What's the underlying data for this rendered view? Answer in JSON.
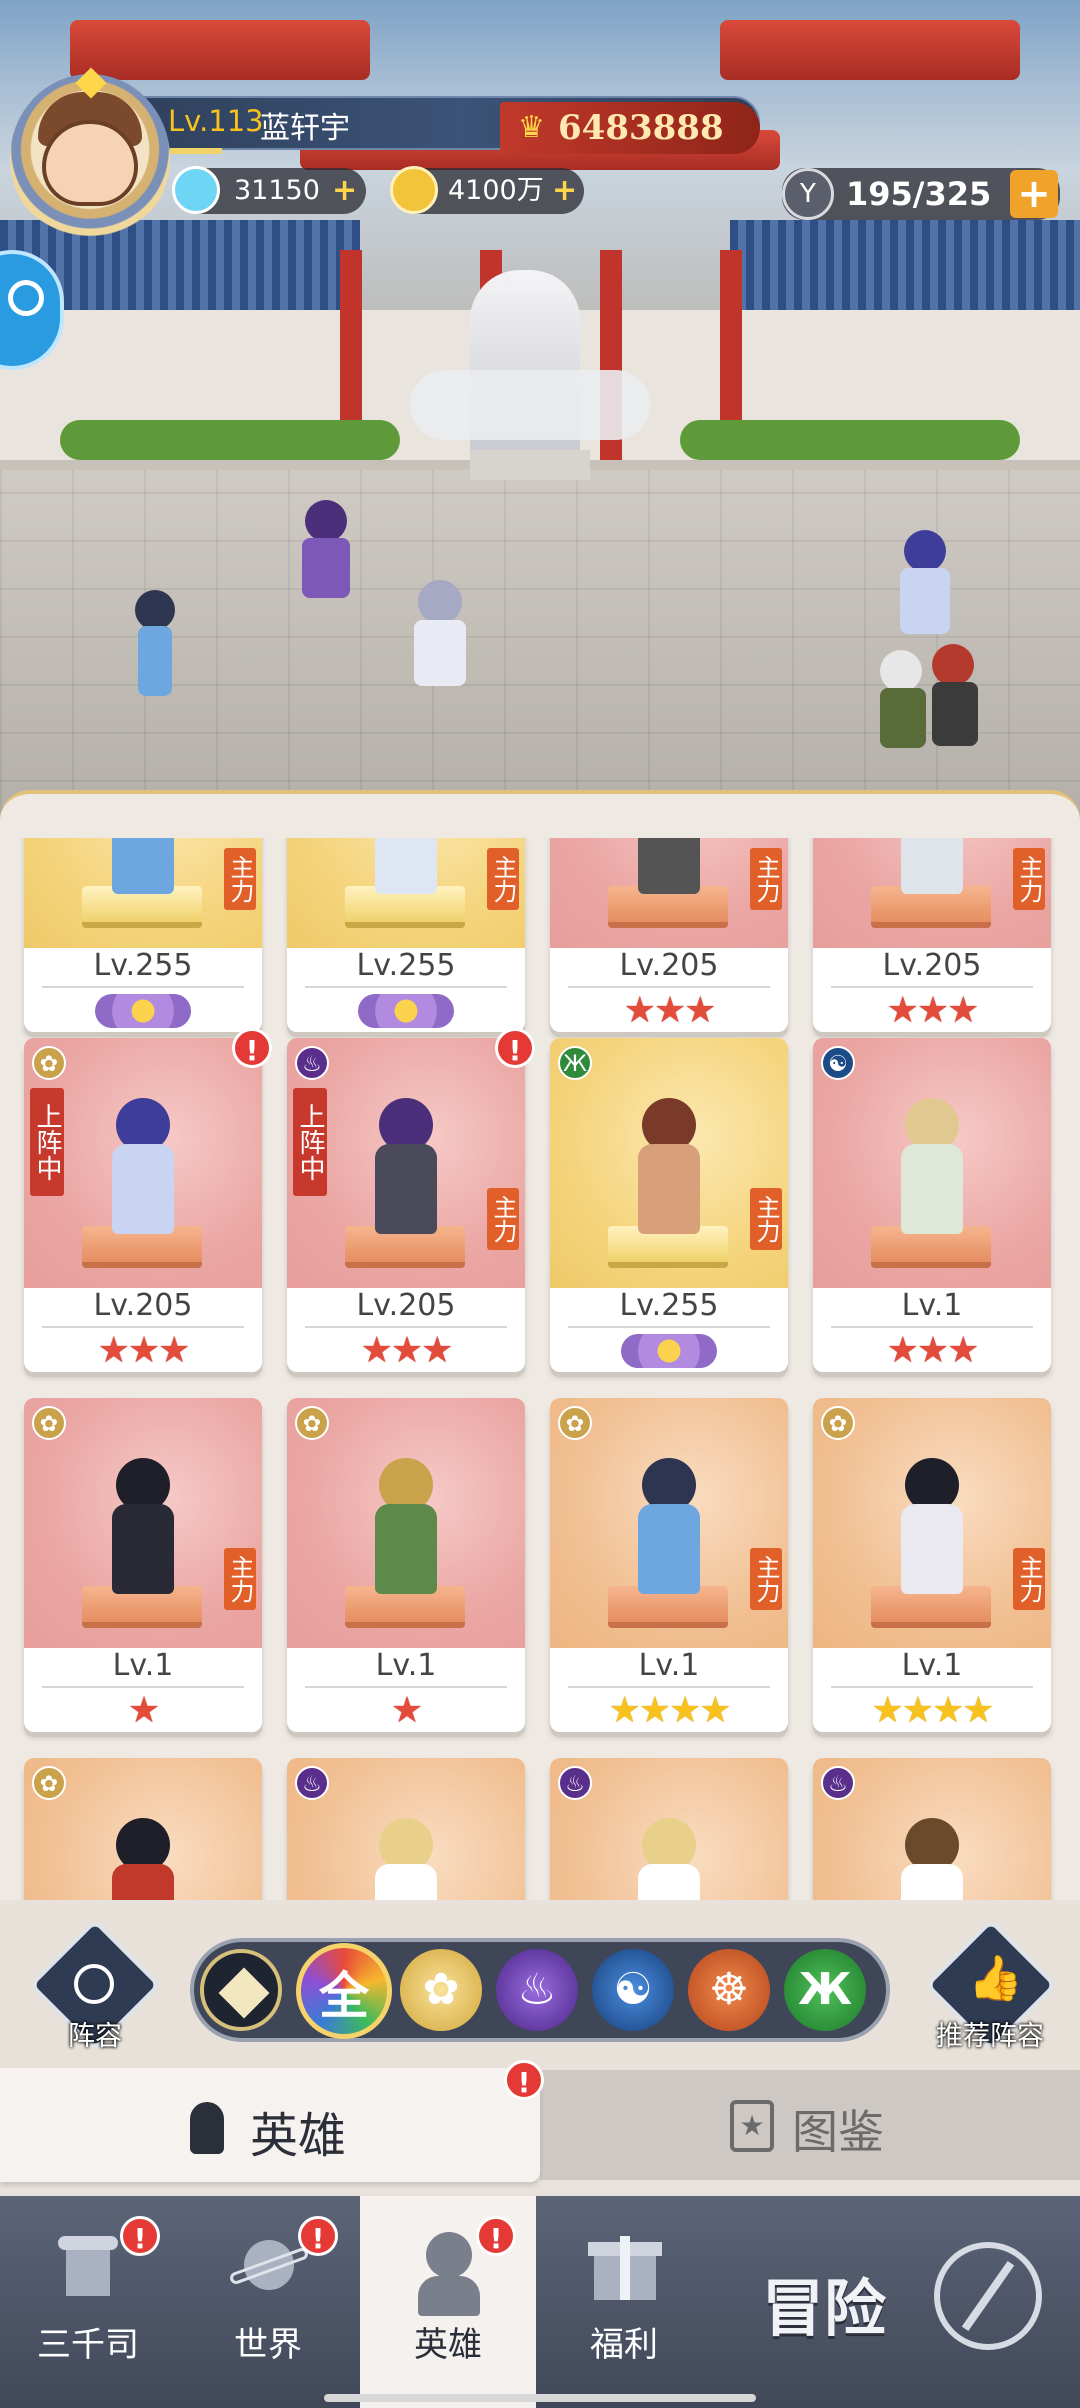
{
  "player": {
    "level": "Lv.113",
    "name": "蓝轩宇",
    "power": "6483888",
    "diamonds": "31150",
    "gold": "4100万",
    "stamina": "195/325"
  },
  "cards": [
    {
      "level": "Lv.255",
      "stars": "",
      "rank": "purple",
      "bg": "gold",
      "faction": "",
      "deployed": false,
      "master": "主力",
      "alert": false
    },
    {
      "level": "Lv.255",
      "stars": "",
      "rank": "purple",
      "bg": "gold",
      "faction": "",
      "deployed": false,
      "master": "主力",
      "alert": false
    },
    {
      "level": "Lv.205",
      "stars": "★★★",
      "rank": "red",
      "bg": "pink",
      "faction": "",
      "deployed": false,
      "master": "主力",
      "alert": false
    },
    {
      "level": "Lv.205",
      "stars": "★★★",
      "rank": "red",
      "bg": "pink",
      "faction": "",
      "deployed": false,
      "master": "主力",
      "alert": false
    },
    {
      "level": "Lv.205",
      "stars": "★★★",
      "rank": "red",
      "bg": "pink",
      "faction": "lotus",
      "deployed": true,
      "master": "",
      "alert": true
    },
    {
      "level": "Lv.205",
      "stars": "★★★",
      "rank": "red",
      "bg": "pink",
      "faction": "flame",
      "deployed": true,
      "master": "主力",
      "alert": true
    },
    {
      "level": "Lv.255",
      "stars": "",
      "rank": "purple",
      "bg": "gold",
      "faction": "dna",
      "deployed": false,
      "master": "主力",
      "alert": false
    },
    {
      "level": "Lv.1",
      "stars": "★★★",
      "rank": "red",
      "bg": "pink",
      "faction": "yin",
      "deployed": false,
      "master": "",
      "alert": false
    },
    {
      "level": "Lv.1",
      "stars": "★",
      "rank": "red",
      "bg": "pink",
      "faction": "lotus",
      "deployed": false,
      "master": "主力",
      "alert": false
    },
    {
      "level": "Lv.1",
      "stars": "★",
      "rank": "red",
      "bg": "pink",
      "faction": "lotus",
      "deployed": false,
      "master": "",
      "alert": false
    },
    {
      "level": "Lv.1",
      "stars": "★★★★",
      "rank": "gold",
      "bg": "orange",
      "faction": "lotus",
      "deployed": false,
      "master": "主力",
      "alert": false
    },
    {
      "level": "Lv.1",
      "stars": "★★★★",
      "rank": "gold",
      "bg": "orange",
      "faction": "lotus",
      "deployed": false,
      "master": "主力",
      "alert": false
    },
    {
      "level": "",
      "stars": "",
      "rank": "red",
      "bg": "orange",
      "faction": "lotus",
      "deployed": false,
      "master": "",
      "alert": false
    },
    {
      "level": "",
      "stars": "",
      "rank": "red",
      "bg": "orange",
      "faction": "flame",
      "deployed": false,
      "master": "",
      "alert": false
    },
    {
      "level": "",
      "stars": "",
      "rank": "red",
      "bg": "orange",
      "faction": "flame",
      "deployed": false,
      "master": "",
      "alert": false
    },
    {
      "level": "",
      "stars": "",
      "rank": "red",
      "bg": "orange",
      "faction": "flame",
      "deployed": false,
      "master": "",
      "alert": false
    }
  ],
  "deploy_label": "上阵中",
  "toolbar": {
    "lineup_label": "阵容",
    "recommend_label": "推荐阵容",
    "all_label": "全"
  },
  "tabs": {
    "heroes": "英雄",
    "codex": "图鉴"
  },
  "nav": {
    "item1": "三千司",
    "item2": "世界",
    "item3": "英雄",
    "item4": "福利",
    "item5": "冒险"
  },
  "colors": {
    "accent_red": "#e53935",
    "power_red": "#c0392b",
    "gold": "#f7c21d"
  }
}
